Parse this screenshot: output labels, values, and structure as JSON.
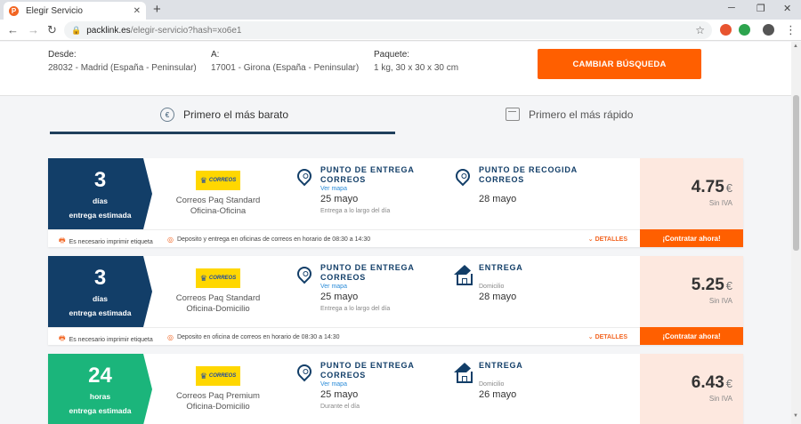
{
  "browser": {
    "tab_title": "Elegir Servicio",
    "favicon_letter": "P",
    "url_host": "packlink.es",
    "url_path": "/elegir-servicio?hash=xo6e1",
    "ext_badge": "4"
  },
  "summary": {
    "from_label": "Desde:",
    "from_value": "28032 - Madrid (España - Peninsular)",
    "to_label": "A:",
    "to_value": "17001 - Girona (España - Peninsular)",
    "package_label": "Paquete:",
    "package_value": "1 kg, 30 x 30 x 30 cm",
    "change_button": "CAMBIAR BÚSQUEDA"
  },
  "sort": {
    "cheapest": "Primero el más barato",
    "fastest": "Primero el más rápido"
  },
  "cards": [
    {
      "badge_num": "3",
      "badge_unit": "días",
      "badge_sub": "entrega estimada",
      "carrier_line1": "Correos Paq Standard",
      "carrier_line2": "Oficina-Oficina",
      "seg1_title": "PUNTO DE ENTREGA CORREOS",
      "seg1_link": "Ver mapa",
      "seg1_date": "25 mayo",
      "seg1_note": "Entrega a lo largo del día",
      "seg2_title": "PUNTO DE RECOGIDA CORREOS",
      "seg2_date": "28 mayo",
      "price": "4.75",
      "currency": "€",
      "tax": "Sin IVA",
      "foot1": "Es necesario imprimir etiqueta",
      "foot2": "Deposito y entrega en oficinas de correos en horario de 08:30 a 14:30",
      "details": "DETALLES",
      "contract": "¡Contratar ahora!"
    },
    {
      "badge_num": "3",
      "badge_unit": "días",
      "badge_sub": "entrega estimada",
      "carrier_line1": "Correos Paq Standard",
      "carrier_line2": "Oficina-Domicilio",
      "seg1_title": "PUNTO DE ENTREGA CORREOS",
      "seg1_link": "Ver mapa",
      "seg1_date": "25 mayo",
      "seg1_note": "Entrega a lo largo del día",
      "seg2_title": "ENTREGA",
      "seg2_tag": "Domicilio",
      "seg2_date": "28 mayo",
      "price": "5.25",
      "currency": "€",
      "tax": "Sin IVA",
      "foot1": "Es necesario imprimir etiqueta",
      "foot2": "Deposito en oficina de correos en horario de 08:30 a 14:30",
      "details": "DETALLES",
      "contract": "¡Contratar ahora!"
    },
    {
      "badge_num": "24",
      "badge_unit": "horas",
      "badge_sub": "entrega estimada",
      "carrier_line1": "Correos Paq Premium",
      "carrier_line2": "Oficina-Domicilio",
      "seg1_title": "PUNTO DE ENTREGA CORREOS",
      "seg1_link": "Ver mapa",
      "seg1_date": "25 mayo",
      "seg1_note": "Durante el día",
      "seg2_title": "ENTREGA",
      "seg2_tag": "Domicilio",
      "seg2_date": "26 mayo",
      "price": "6.43",
      "currency": "€",
      "tax": "Sin IVA"
    }
  ],
  "logo_text": "CORREOS",
  "colors": {
    "brand_orange": "#ff5f00",
    "navy": "#123e68",
    "green": "#1bb57b",
    "price_bg": "#fde8df"
  }
}
